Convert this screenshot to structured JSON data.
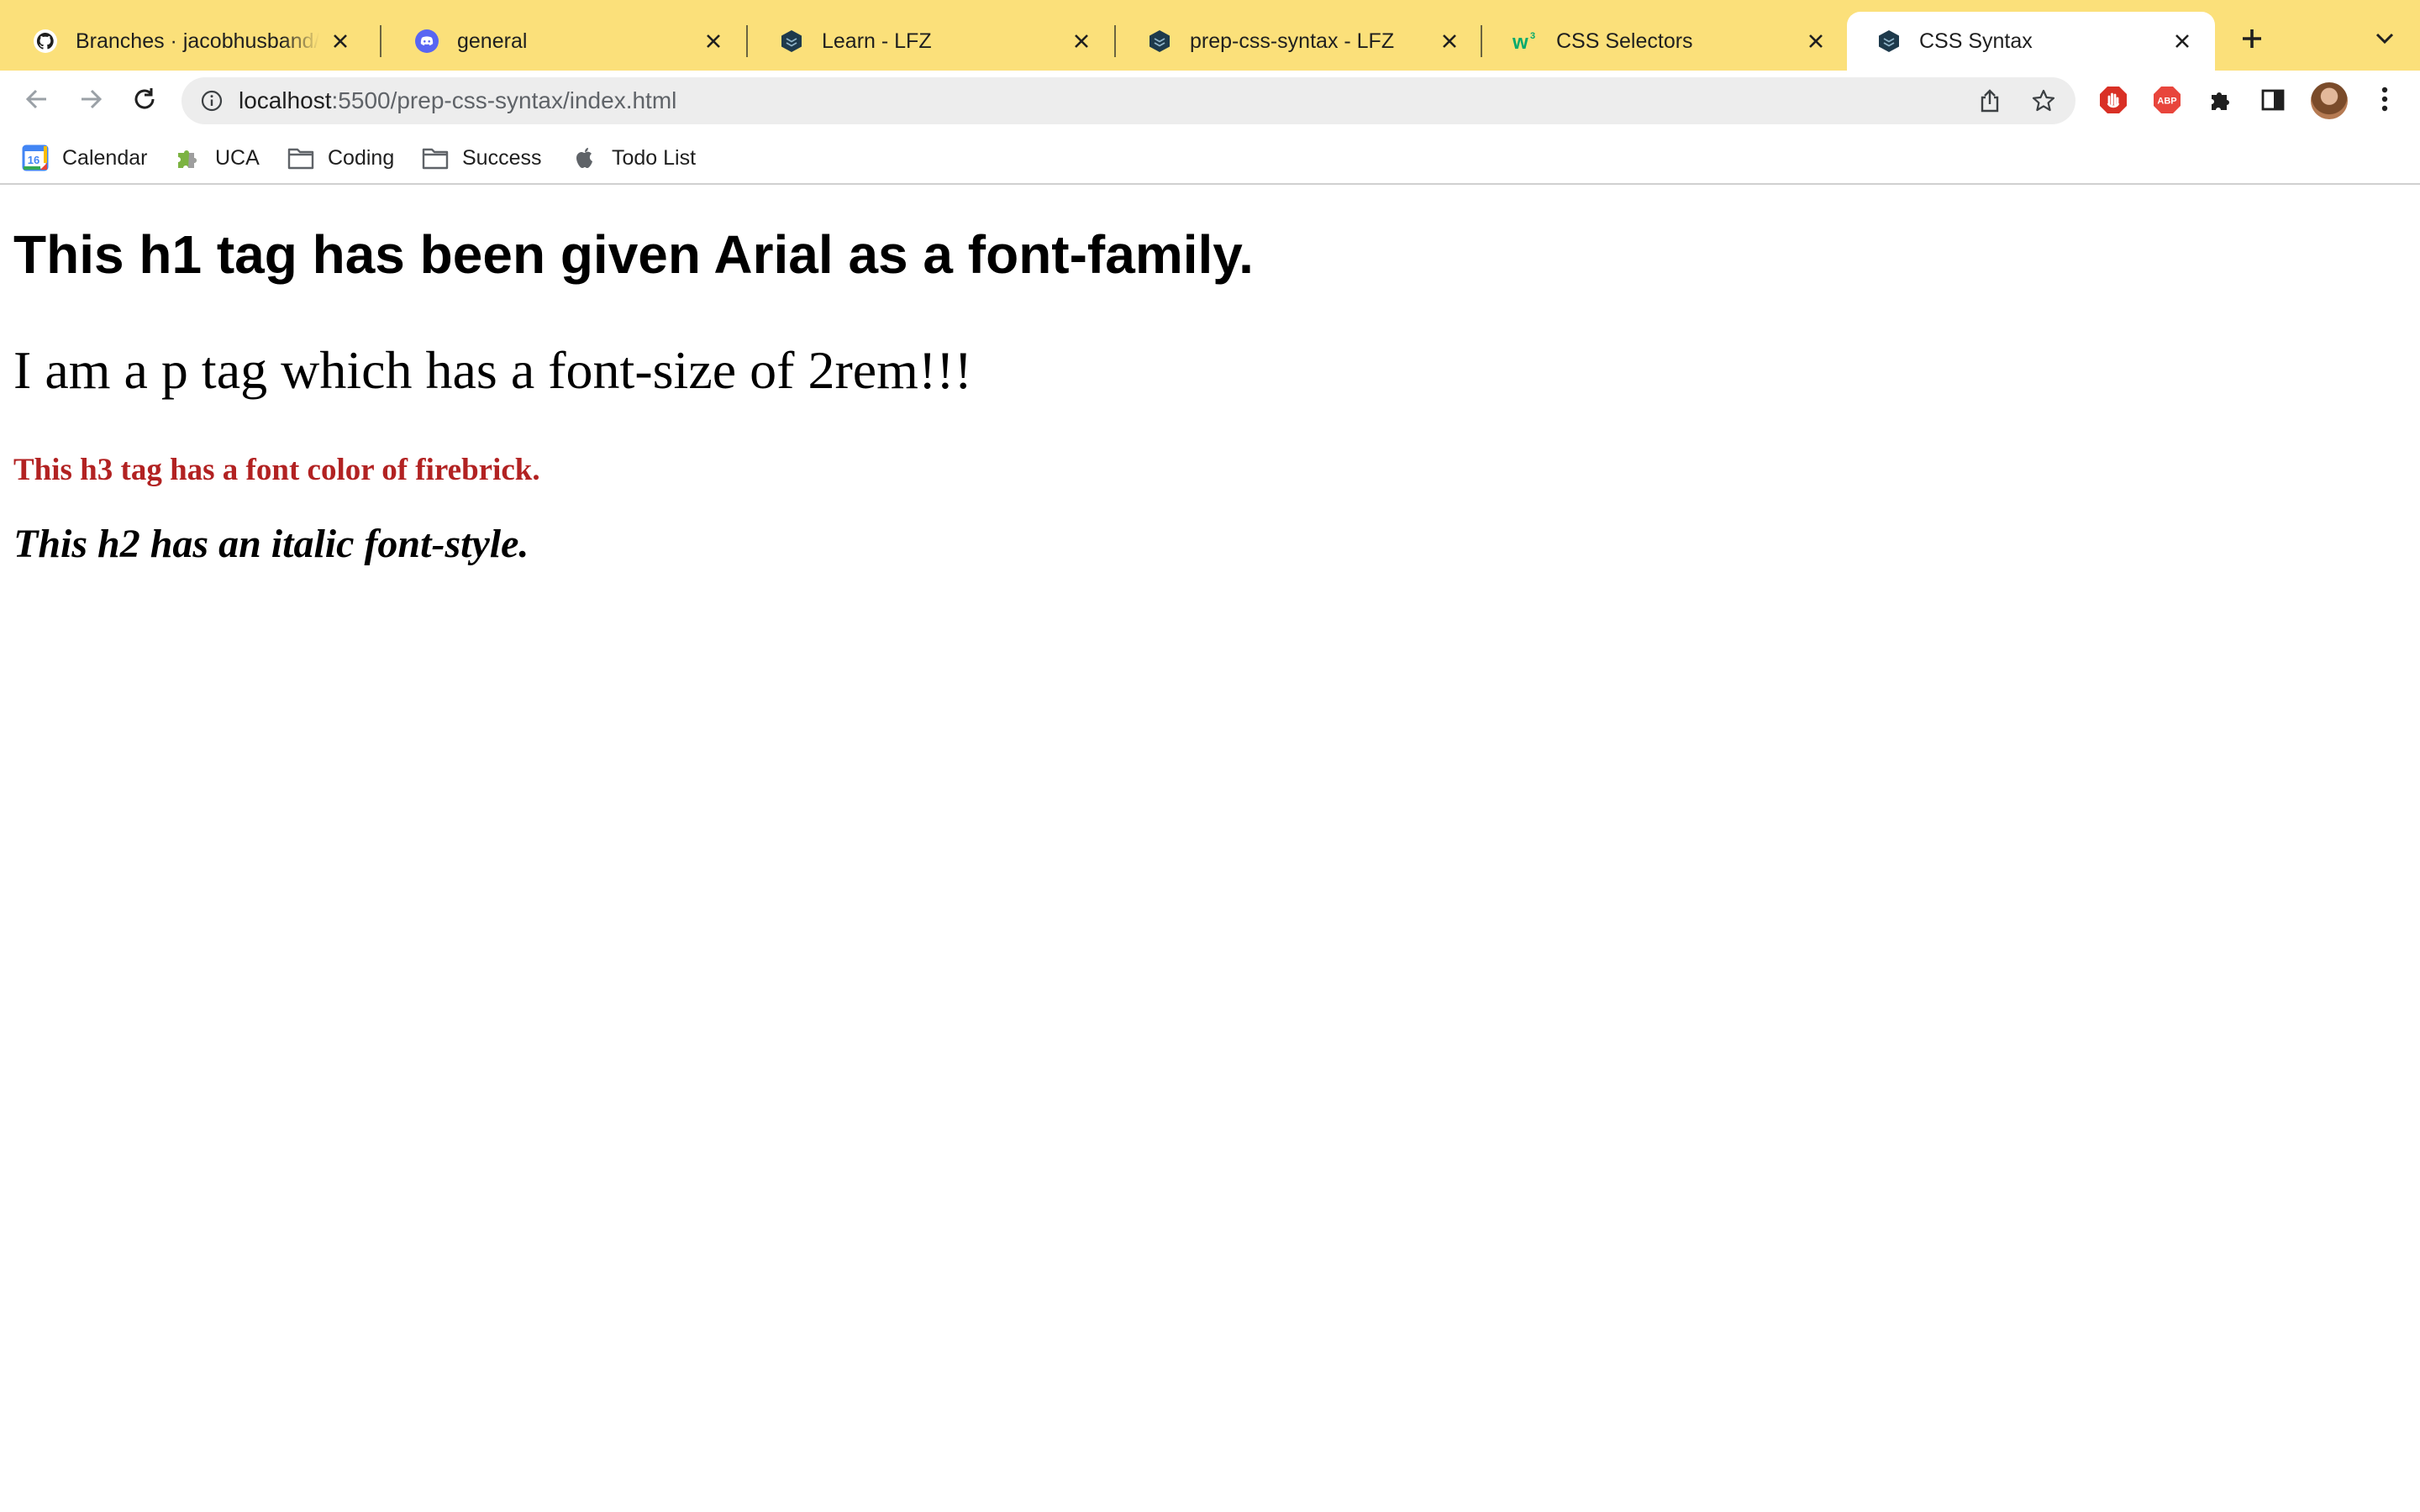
{
  "browser": {
    "tabs": [
      {
        "title": "Branches · jacobhusband/p",
        "icon": "github-icon",
        "active": false
      },
      {
        "title": "general",
        "icon": "discord-icon",
        "active": false
      },
      {
        "title": "Learn - LFZ",
        "icon": "lfz-icon",
        "active": false
      },
      {
        "title": "prep-css-syntax - LFZ",
        "icon": "lfz-icon",
        "active": false
      },
      {
        "title": "CSS Selectors",
        "icon": "w3schools-icon",
        "active": false
      },
      {
        "title": "CSS Syntax",
        "icon": "lfz-icon",
        "active": true
      }
    ],
    "address": {
      "host": "localhost",
      "path": ":5500/prep-css-syntax/index.html"
    },
    "bookmarks": [
      {
        "label": "Calendar",
        "icon": "calendar-icon",
        "icon_text": "16"
      },
      {
        "label": "UCA",
        "icon": "puzzle-icon"
      },
      {
        "label": "Coding",
        "icon": "folder-icon"
      },
      {
        "label": "Success",
        "icon": "folder-icon"
      },
      {
        "label": "Todo List",
        "icon": "apple-icon"
      }
    ],
    "extensions": {
      "abp_label": "ABP"
    },
    "colors": {
      "tabstrip": "#fbe07a",
      "omnibox": "#ededed"
    }
  },
  "page": {
    "h1": "This h1 tag has been given Arial as a font-family.",
    "p": "I am a p tag which has a font-size of 2rem!!!",
    "h3": "This h3 tag has a font color of firebrick.",
    "h2": "This h2 has an italic font-style.",
    "h3_color": "#b22222"
  }
}
